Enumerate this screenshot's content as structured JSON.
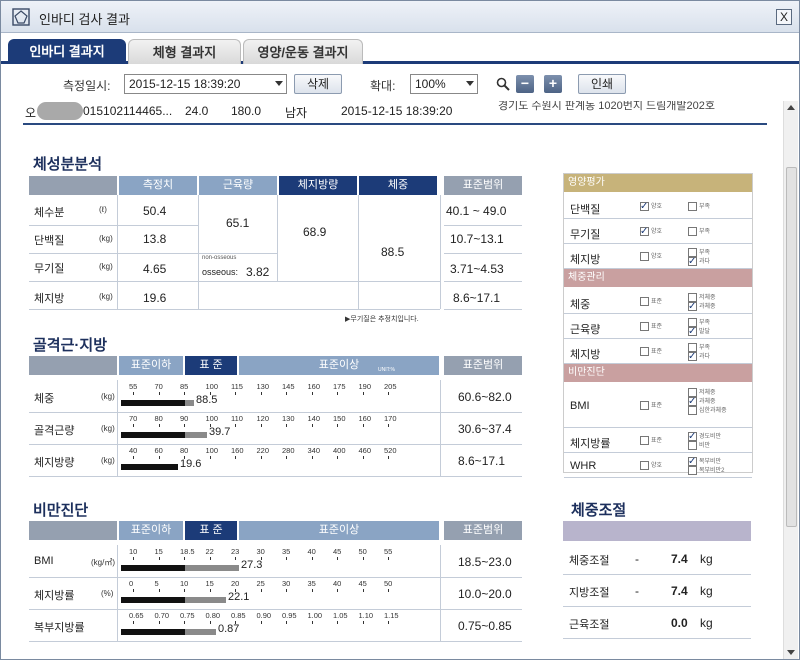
{
  "window": {
    "title": "인바디 검사 결과",
    "close": "X"
  },
  "tabs": [
    {
      "label": "인바디 결과지"
    },
    {
      "label": "체형 결과지"
    },
    {
      "label": "영양/운동 결과지"
    }
  ],
  "toolbar": {
    "date_label": "측정일시:",
    "date_value": "2015-12-15 18:39:20",
    "delete_label": "삭제",
    "zoom_label": "확대:",
    "zoom_value": "100%",
    "zoom_out": "−",
    "zoom_in": "+",
    "print_label": "인쇄"
  },
  "patient": {
    "name_initial": "오",
    "id": "015102114465...",
    "age": "24.0",
    "height": "180.0",
    "gender": "남자",
    "datetime": "2015-12-15  18:39:20",
    "address": "경기도 수원시 판계동 1020번지 드림개발202호"
  },
  "body_comp": {
    "title": "체성분분석",
    "headers": [
      "측정치",
      "근육량",
      "체지방량",
      "체중",
      "표준범위"
    ],
    "rows": [
      {
        "label": "체수분",
        "unit": "(ℓ)",
        "value": "50.4",
        "range": "40.1 ~ 49.0"
      },
      {
        "label": "단백질",
        "unit": "(kg)",
        "value": "13.8",
        "range": "10.7~13.1"
      },
      {
        "label": "무기질",
        "unit": "(kg)",
        "value": "4.65",
        "range": "3.71~4.53"
      },
      {
        "label": "체지방",
        "unit": "(kg)",
        "value": "19.6",
        "range": "8.6~17.1"
      }
    ],
    "muscle": "65.1",
    "nonosseous_label": "non-osseous",
    "osseous_label": "osseous:",
    "osseous": "3.82",
    "fat_mass": "68.9",
    "weight": "88.5",
    "footnote": "▶무기질은 추정치입니다."
  },
  "muscle_fat": {
    "title": "골격근·지방",
    "headers": [
      "표준이하",
      "표 준",
      "표준이상",
      "표준범위"
    ],
    "unit_label": "UNIT:%",
    "rows": [
      {
        "label": "체중",
        "unit": "(kg)",
        "ticks": [
          "55",
          "70",
          "85",
          "100",
          "115",
          "130",
          "145",
          "160",
          "175",
          "190",
          "205"
        ],
        "value": "88.5",
        "fill": 0.23,
        "range": "60.6~82.0"
      },
      {
        "label": "골격근량",
        "unit": "(kg)",
        "ticks": [
          "70",
          "80",
          "90",
          "100",
          "110",
          "120",
          "130",
          "140",
          "150",
          "160",
          "170"
        ],
        "value": "39.7",
        "fill": 0.27,
        "range": "30.6~37.4"
      },
      {
        "label": "체지방량",
        "unit": "(kg)",
        "ticks": [
          "40",
          "60",
          "80",
          "100",
          "160",
          "220",
          "280",
          "340",
          "400",
          "460",
          "520"
        ],
        "value": "19.6",
        "fill": 0.18,
        "range": "8.6~17.1"
      }
    ]
  },
  "obesity": {
    "title": "비만진단",
    "headers": [
      "표준이하",
      "표 준",
      "표준이상",
      "표준범위"
    ],
    "rows": [
      {
        "label": "BMI",
        "unit": "(kg/㎡)",
        "ticks": [
          "10",
          "15",
          "18.5",
          "22",
          "23",
          "30",
          "35",
          "40",
          "45",
          "50",
          "55"
        ],
        "value": "27.3",
        "fill": 0.37,
        "range": "18.5~23.0"
      },
      {
        "label": "체지방률",
        "unit": "(%)",
        "ticks": [
          "0",
          "5",
          "10",
          "15",
          "20",
          "25",
          "30",
          "35",
          "40",
          "45",
          "50"
        ],
        "value": "22.1",
        "fill": 0.33,
        "range": "10.0~20.0"
      },
      {
        "label": "복부지방률",
        "unit": "",
        "ticks": [
          "0.65",
          "0.70",
          "0.75",
          "0.80",
          "0.85",
          "0.90",
          "0.95",
          "1.00",
          "1.05",
          "1.10",
          "1.15"
        ],
        "value": "0.87",
        "fill": 0.3,
        "range": "0.75~0.85"
      }
    ]
  },
  "nutrition": {
    "title": "영양평가",
    "rows": [
      {
        "label": "단백질",
        "opts": [
          "양호",
          "부족"
        ],
        "checked": [
          true,
          false
        ]
      },
      {
        "label": "무기질",
        "opts": [
          "양호",
          "부족"
        ],
        "checked": [
          true,
          false
        ]
      },
      {
        "label": "체지방",
        "opts": [
          "양호",
          "부족",
          "과다"
        ],
        "checked": [
          false,
          false,
          true
        ]
      }
    ]
  },
  "weight_mgmt": {
    "title": "체중관리",
    "rows": [
      {
        "label": "체중",
        "opts": [
          "표준",
          "저체중",
          "과체중"
        ],
        "checked": [
          false,
          false,
          true
        ]
      },
      {
        "label": "근육량",
        "opts": [
          "표준",
          "부족",
          "발달"
        ],
        "checked": [
          false,
          false,
          true
        ]
      },
      {
        "label": "체지방",
        "opts": [
          "표준",
          "부족",
          "과다"
        ],
        "checked": [
          false,
          false,
          true
        ]
      }
    ]
  },
  "obesity_diag": {
    "title": "비만진단",
    "rows": [
      {
        "label": "BMI",
        "opts": [
          "표준",
          "저체중",
          "과체중",
          "심한과체중"
        ],
        "checked": [
          false,
          false,
          true,
          false
        ]
      },
      {
        "label": "체지방률",
        "opts": [
          "표준",
          "경도비만",
          "비만"
        ],
        "checked": [
          false,
          true,
          false
        ]
      },
      {
        "label": "WHR",
        "opts": [
          "양호",
          "복부비만",
          "복부비만2"
        ],
        "checked": [
          false,
          true,
          false
        ]
      }
    ]
  },
  "weight_control": {
    "title": "체중조절",
    "rows": [
      {
        "label": "체중조절",
        "sign": "-",
        "value": "7.4",
        "unit": "kg"
      },
      {
        "label": "지방조절",
        "sign": "-",
        "value": "7.4",
        "unit": "kg"
      },
      {
        "label": "근육조절",
        "sign": "",
        "value": "0.0",
        "unit": "kg"
      }
    ]
  }
}
